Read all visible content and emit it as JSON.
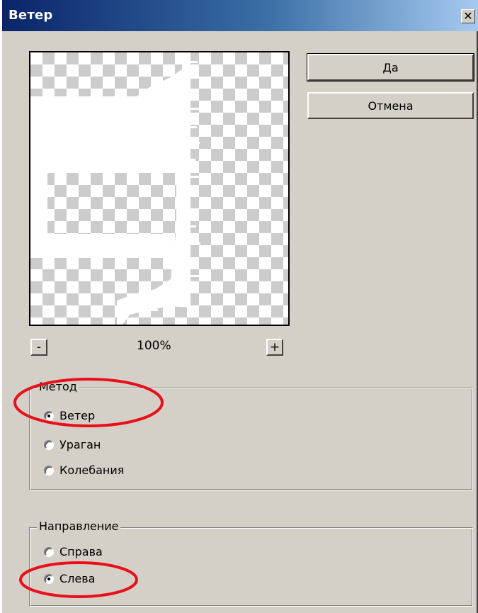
{
  "window": {
    "title": "Ветер",
    "close_symbol": "✕"
  },
  "buttons": {
    "ok": "Да",
    "cancel": "Отмена"
  },
  "zoom": {
    "minus": "-",
    "value": "100%",
    "plus": "+"
  },
  "method": {
    "legend": "Метод",
    "options": [
      {
        "label": "Ветер",
        "checked": true
      },
      {
        "label": "Ураган",
        "checked": false
      },
      {
        "label": "Колебания",
        "checked": false
      }
    ]
  },
  "direction": {
    "legend": "Направление",
    "options": [
      {
        "label": "Справа",
        "checked": false
      },
      {
        "label": "Слева",
        "checked": true
      }
    ]
  },
  "colors": {
    "titlebar_start": "#0a246a",
    "titlebar_end": "#a6caf0",
    "dialog_bg": "#d4d0c8",
    "highlight_ellipse": "#e8101a"
  }
}
